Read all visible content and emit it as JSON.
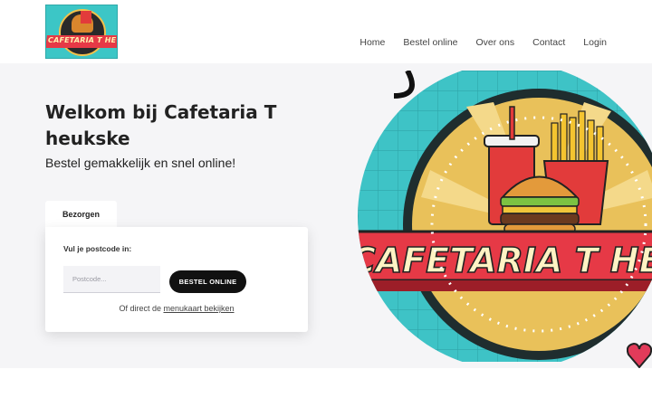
{
  "header": {
    "logo_text": "CAFETARIA T HEUKSKE",
    "nav": [
      "Home",
      "Bestel online",
      "Over ons",
      "Contact",
      "Login"
    ]
  },
  "hero": {
    "title": "Welkom bij Cafetaria T heukske",
    "subtitle": "Bestel gemakkelijk en snel online!",
    "image_text": "CAFETARIA T HEUKSKE"
  },
  "order": {
    "tab_label": "Bezorgen",
    "postcode_label": "Vul je postcode in:",
    "postcode_placeholder": "Postcode...",
    "postcode_value": "",
    "button_label": "BESTEL ONLINE",
    "menu_prefix": "Of direct de ",
    "menu_link": "menukaart bekijken"
  },
  "colors": {
    "accent": "#111111",
    "hero_bg": "#f5f5f7",
    "logo_teal": "#3cc6c6",
    "banner_red": "#e63946"
  }
}
